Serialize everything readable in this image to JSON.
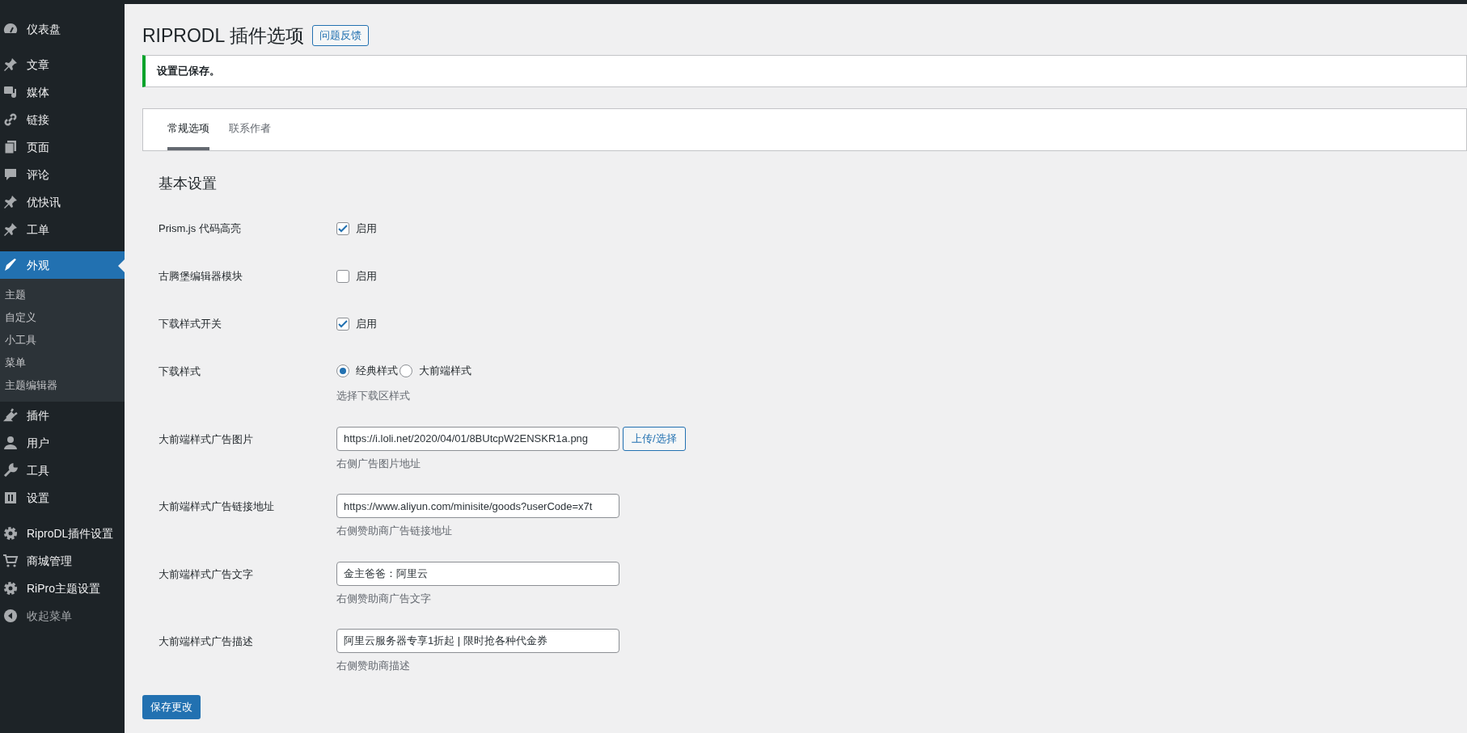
{
  "sidebar": {
    "groups": [
      [
        {
          "label": "仪表盘",
          "selected": false
        }
      ],
      [
        {
          "label": "文章",
          "selected": false
        },
        {
          "label": "媒体",
          "selected": false
        },
        {
          "label": "链接",
          "selected": false
        },
        {
          "label": "页面",
          "selected": false
        },
        {
          "label": "评论",
          "selected": false
        },
        {
          "label": "优快讯",
          "selected": false
        },
        {
          "label": "工单",
          "selected": false
        }
      ],
      [
        {
          "label": "外观",
          "selected": true,
          "children": [
            {
              "label": "主题"
            },
            {
              "label": "自定义"
            },
            {
              "label": "小工具"
            },
            {
              "label": "菜单"
            },
            {
              "label": "主题编辑器"
            }
          ]
        },
        {
          "label": "插件",
          "selected": false
        },
        {
          "label": "用户",
          "selected": false
        },
        {
          "label": "工具",
          "selected": false
        },
        {
          "label": "设置",
          "selected": false
        }
      ],
      [
        {
          "label": "RiproDL插件设置",
          "selected": false
        },
        {
          "label": "商城管理",
          "selected": false
        },
        {
          "label": "RiPro主题设置",
          "selected": false
        }
      ]
    ],
    "collapse": "收起菜单"
  },
  "page": {
    "title": "RIPRODL 插件选项",
    "title_button": "问题反馈",
    "notice": "设置已保存。",
    "tabs": [
      {
        "label": "常规选项",
        "selected": true
      },
      {
        "label": "联系作者",
        "selected": false
      }
    ],
    "section_title": "基本设置",
    "fields": [
      {
        "kind": "checkbox",
        "label": "Prism.js 代码高亮",
        "option": "启用",
        "checked": true
      },
      {
        "kind": "checkbox",
        "label": "古腾堡编辑器模块",
        "option": "启用",
        "checked": false
      },
      {
        "kind": "checkbox",
        "label": "下载样式开关",
        "option": "启用",
        "checked": true
      },
      {
        "kind": "radio",
        "label": "下载样式",
        "options": [
          {
            "label": "经典样式",
            "selected": true
          },
          {
            "label": "大前端样式",
            "selected": false
          }
        ],
        "description": "选择下载区样式"
      },
      {
        "kind": "text",
        "label": "大前端样式广告图片",
        "value": "https://i.loli.net/2020/04/01/8BUtcpW2ENSKR1a.png",
        "button": "上传/选择",
        "description": "右侧广告图片地址"
      },
      {
        "kind": "text",
        "label": "大前端样式广告链接地址",
        "value": "https://www.aliyun.com/minisite/goods?userCode=x7t",
        "description": "右侧赞助商广告链接地址"
      },
      {
        "kind": "text",
        "label": "大前端样式广告文字",
        "value": "金主爸爸：阿里云",
        "description": "右侧赞助商广告文字"
      },
      {
        "kind": "text",
        "label": "大前端样式广告描述",
        "value": "阿里云服务器专享1折起 | 限时抢各种代金券",
        "description": "右侧赞助商描述"
      }
    ],
    "save_button": "保存更改"
  }
}
